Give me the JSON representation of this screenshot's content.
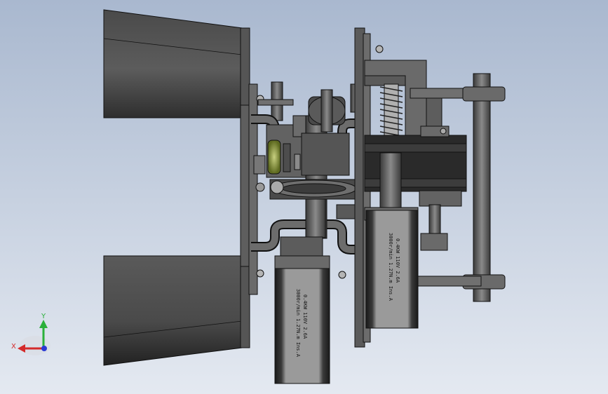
{
  "scene": {
    "background_top": "#a9b8cf",
    "background_bottom": "#e4e9f1",
    "part_color": "#5a5a5a",
    "part_dark": "#3a3a3a",
    "part_light": "#8c8c8c",
    "edge_color": "#111111",
    "bearing_color": "#7e8a3a",
    "spring_color": "#9a9a9a"
  },
  "motor_left": {
    "label_line1": "0.4KW 110V 2.6A",
    "label_line2": "3000r/min 1.27N.m Ins.A"
  },
  "motor_right": {
    "label_line1": "0.4KW 110V 2.6A",
    "label_line2": "3000r/min 1.27N.m Ins.A"
  },
  "triad": {
    "x_label": "X",
    "y_label": "Y",
    "x_color": "#d42a2a",
    "y_color": "#2ab03a",
    "z_color": "#2a3ad4"
  }
}
